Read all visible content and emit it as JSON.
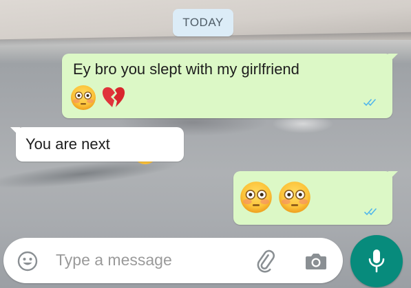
{
  "chat": {
    "date_label": "TODAY",
    "messages": [
      {
        "direction": "outgoing",
        "text": "Ey bro you slept with my girlfriend",
        "emojis": [
          "flushed-face-emoji",
          "broken-heart-emoji"
        ],
        "status": "read",
        "status_icon": "double-check-icon"
      },
      {
        "direction": "incoming",
        "text": "You are next"
      },
      {
        "direction": "outgoing",
        "text": "",
        "emojis": [
          "flushed-face-emoji",
          "flushed-face-emoji"
        ],
        "status": "read",
        "status_icon": "double-check-icon"
      }
    ]
  },
  "composer": {
    "placeholder": "Type a message",
    "left_icon": "emoji-icon",
    "attach_icon": "paperclip-icon",
    "camera_icon": "camera-icon",
    "send_icon": "microphone-icon"
  },
  "colors": {
    "outgoing_bubble": "#dcf8c6",
    "incoming_bubble": "#ffffff",
    "date_chip": "#dcecf7",
    "read_ticks": "#4fb6ec",
    "mic_button": "#078b7c"
  }
}
